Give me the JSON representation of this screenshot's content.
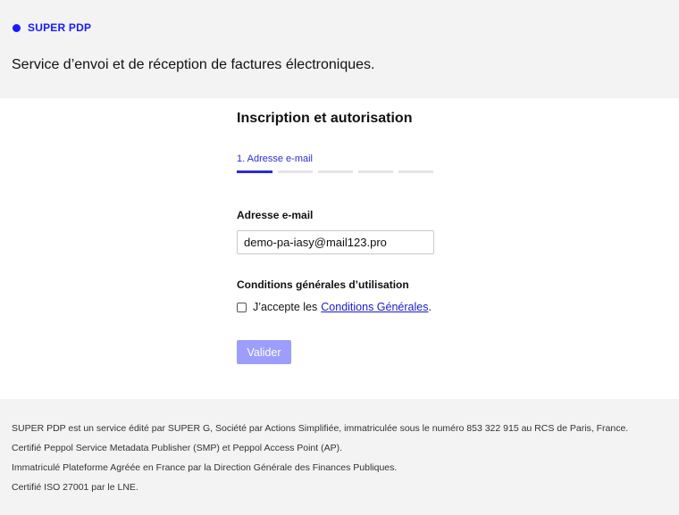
{
  "header": {
    "brand": "SUPER PDP",
    "tagline": "Service d’envoi et de réception de factures électroniques."
  },
  "form": {
    "title": "Inscription et autorisation",
    "step_label": "1. Adresse e-mail",
    "steps_total": 5,
    "current_step": 1,
    "email_label": "Adresse e-mail",
    "email_value": "demo-pa-iasy@mail123.pro",
    "cgu_title": "Conditions générales d’utilisation",
    "cgu_accept_text": "J’accepte les",
    "cgu_link_text": "Conditions Générales",
    "cgu_period": ".",
    "cgu_checked": false,
    "submit_label": "Valider"
  },
  "footer": {
    "line1": "SUPER PDP est un service édité par SUPER G, Société par Actions Simplifiée, immatriculée sous le numéro 853 322 915 au RCS de Paris, France.",
    "line2": "Certifié Peppol Service Metadata Publisher (SMP) et Peppol Access Point (AP).",
    "line3": "Immatriculé Plateforme Agréée en France par la Direction Générale des Finances Publiques.",
    "line4": "Certifié ISO 27001 par le LNE."
  },
  "colors": {
    "accent": "#1a1aff",
    "button": "#9d9dfb",
    "header_bg": "#f3f3f3"
  }
}
